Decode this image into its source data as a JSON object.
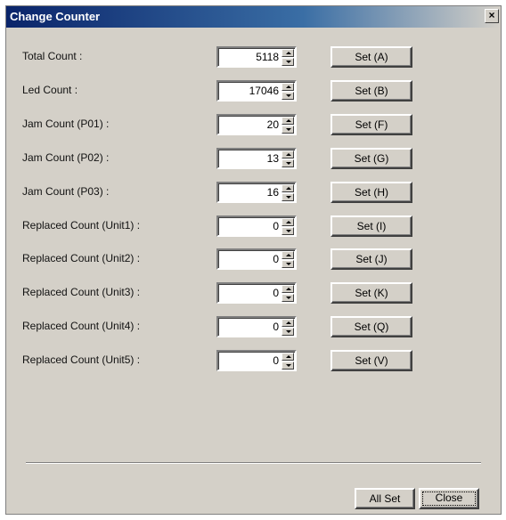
{
  "window": {
    "title": "Change Counter",
    "close_glyph": "×"
  },
  "rows": [
    {
      "label": "Total Count :",
      "value": "5118",
      "button": "Set (A)"
    },
    {
      "label": "Led Count :",
      "value": "17046",
      "button": "Set (B)"
    },
    {
      "label": "Jam Count (P01) :",
      "value": "20",
      "button": "Set (F)"
    },
    {
      "label": "Jam Count (P02) :",
      "value": "13",
      "button": "Set (G)"
    },
    {
      "label": "Jam Count (P03) :",
      "value": "16",
      "button": "Set (H)"
    },
    {
      "label": "Replaced Count (Unit1) :",
      "value": "0",
      "button": "Set (I)"
    },
    {
      "label": "Replaced Count (Unit2) :",
      "value": "0",
      "button": "Set (J)"
    },
    {
      "label": "Replaced Count (Unit3) :",
      "value": "0",
      "button": "Set (K)"
    },
    {
      "label": "Replaced Count (Unit4) :",
      "value": "0",
      "button": "Set (Q)"
    },
    {
      "label": "Replaced Count (Unit5) :",
      "value": "0",
      "button": "Set (V)"
    }
  ],
  "footer": {
    "all_set_label": "All Set",
    "close_label": "Close"
  },
  "colors": {
    "dialog_bg": "#d4d0c8",
    "title_bar": "#0a246a"
  }
}
